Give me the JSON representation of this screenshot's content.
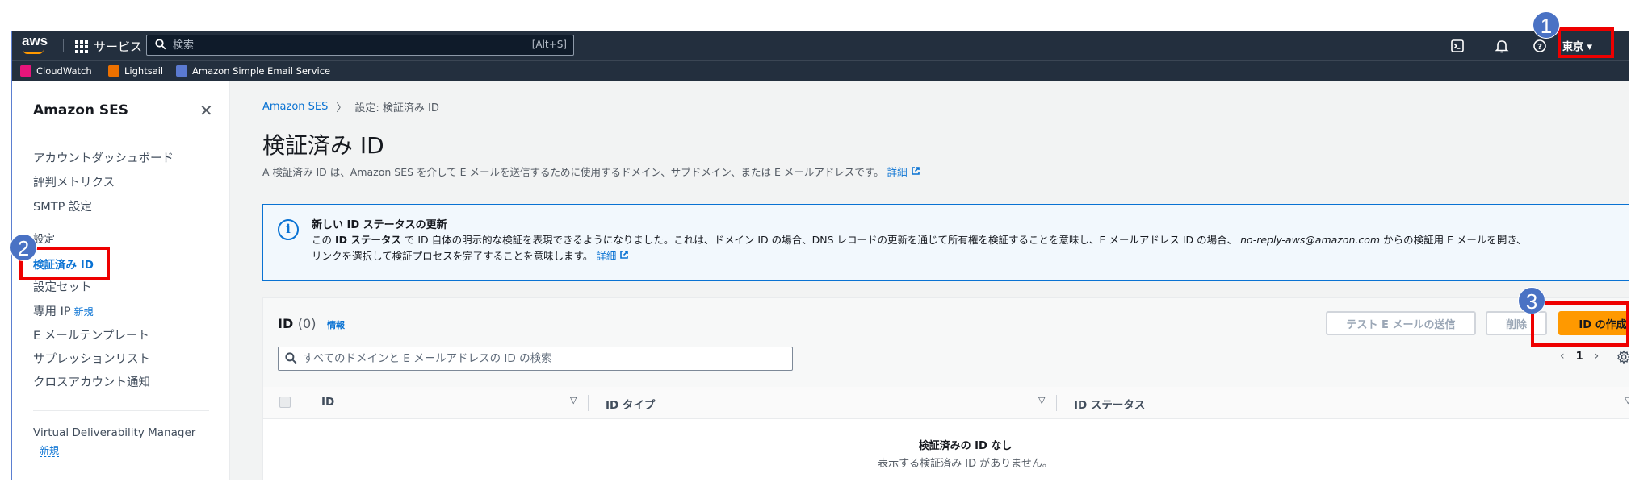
{
  "topbar": {
    "logo": "aws",
    "services_label": "サービス",
    "search_placeholder": "検索",
    "search_shortcut": "[Alt+S]",
    "region": "東京 ▾"
  },
  "favorites": [
    {
      "label": "CloudWatch",
      "color": "#e7157b"
    },
    {
      "label": "Lightsail",
      "color": "#ed7100"
    },
    {
      "label": "Amazon Simple Email Service",
      "color": "#7aa116"
    }
  ],
  "sidebar": {
    "title": "Amazon SES",
    "close": "✕",
    "group1": [
      "アカウントダッシュボード",
      "評判メトリクス",
      "SMTP 設定"
    ],
    "group2_header": "設定",
    "items": {
      "verified_ids": "検証済み ID",
      "config_sets": "設定セット",
      "dedicated_ip": "専用 IP",
      "dedicated_ip_badge": "新規",
      "templates": "E メールテンプレート",
      "suppression": "サプレッションリスト",
      "cross_account": "クロスアカウント通知"
    },
    "vdm": "Virtual Deliverability Manager",
    "vdm_badge": "新規"
  },
  "breadcrumb": {
    "root": "Amazon SES",
    "sep": "〉",
    "current": "設定: 検証済み ID"
  },
  "page": {
    "title": "検証済み ID",
    "desc": "A 検証済み ID は、Amazon SES を介して E メールを送信するために使用するドメイン、サブドメイン、または E メールアドレスです。",
    "desc_link": "詳細"
  },
  "info": {
    "icon": "i",
    "title": "新しい ID ステータスの更新",
    "body_pre": "この ",
    "body_bold": "ID ステータス",
    "body_mid": " で ID 自体の明示的な検証を表現できるようになりました。これは、ドメイン ID の場合、DNS レコードの更新を通じて所有権を検証することを意味し、E メールアドレス ID の場合、",
    "body_italic": "no-reply-aws@amazon.com",
    "body_post": " からの検証用 E メールを開き、",
    "body_line2": "リンクを選択して検証プロセスを完了することを意味します。",
    "body_link": "詳細"
  },
  "id_panel": {
    "title": "ID",
    "count": "(0)",
    "info_link": "情報",
    "btn_send_test": "テスト E メールの送信",
    "btn_delete": "削除",
    "btn_create": "ID の作成",
    "search_placeholder": "すべてのドメインと E メールアドレスの ID の検索",
    "page_num": "1",
    "columns": [
      "ID",
      "ID タイプ",
      "ID ステータス"
    ],
    "empty_title": "検証済みの ID なし",
    "empty_desc": "表示する検証済み ID がありません。"
  },
  "annotations": [
    "1",
    "2",
    "3"
  ]
}
